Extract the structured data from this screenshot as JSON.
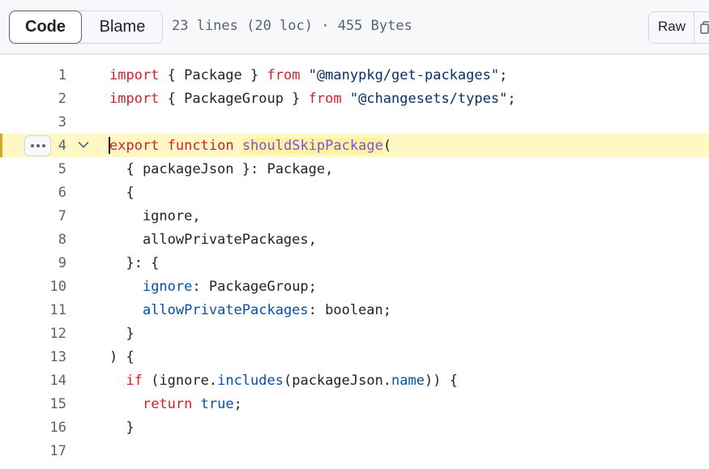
{
  "toolbar": {
    "code_tab": "Code",
    "blame_tab": "Blame",
    "file_info": "23 lines (20 loc) · 455 Bytes",
    "raw_label": "Raw"
  },
  "code": {
    "lines": [
      {
        "n": "1"
      },
      {
        "n": "2"
      },
      {
        "n": "3"
      },
      {
        "n": "4"
      },
      {
        "n": "5"
      },
      {
        "n": "6"
      },
      {
        "n": "7"
      },
      {
        "n": "8"
      },
      {
        "n": "9"
      },
      {
        "n": "10"
      },
      {
        "n": "11"
      },
      {
        "n": "12"
      },
      {
        "n": "13"
      },
      {
        "n": "14"
      },
      {
        "n": "15"
      },
      {
        "n": "16"
      },
      {
        "n": "17"
      }
    ],
    "tokens": {
      "l1": [
        "import",
        " { Package } ",
        "from",
        " ",
        "\"@manypkg/get-packages\"",
        ";"
      ],
      "l2": [
        "import",
        " { PackageGroup } ",
        "from",
        " ",
        "\"@changesets/types\"",
        ";"
      ],
      "l4": [
        "export",
        " ",
        "function",
        " ",
        "shouldSkipPackage",
        "("
      ],
      "l5": [
        "  { packageJson }: Package,"
      ],
      "l6": [
        "  {"
      ],
      "l7": [
        "    ignore,"
      ],
      "l8": [
        "    allowPrivatePackages,"
      ],
      "l9": [
        "  }: {"
      ],
      "l10": [
        "    ",
        "ignore",
        ": PackageGroup;"
      ],
      "l11": [
        "    ",
        "allowPrivatePackages",
        ": boolean;"
      ],
      "l12": [
        "  }"
      ],
      "l13": [
        ") {"
      ],
      "l14": [
        "  ",
        "if",
        " (ignore.",
        "includes",
        "(packageJson.",
        "name",
        ")) {"
      ],
      "l15": [
        "    ",
        "return",
        " ",
        "true",
        ";"
      ],
      "l16": [
        "  }"
      ]
    }
  },
  "colors": {
    "keyword": "#cf222e",
    "string": "#0a3069",
    "function": "#8250df",
    "property": "#0550ae",
    "highlight": "#fff8c5"
  },
  "icons": [
    "kebab-horizontal-icon",
    "chevron-down-icon",
    "copy-icon"
  ]
}
